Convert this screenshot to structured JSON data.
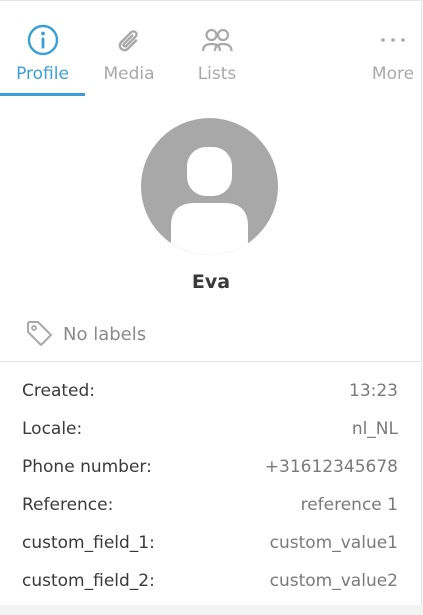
{
  "tabs": [
    {
      "label": "Profile",
      "icon": "info-icon",
      "active": true
    },
    {
      "label": "Media",
      "icon": "paperclip-icon",
      "active": false
    },
    {
      "label": "Lists",
      "icon": "users-icon",
      "active": false
    },
    {
      "label": "More",
      "icon": "more-icon",
      "active": false
    }
  ],
  "contact": {
    "name": "Eva",
    "labels_text": "No labels"
  },
  "details": [
    {
      "key": "Created:",
      "value": "13:23"
    },
    {
      "key": "Locale:",
      "value": "nl_NL"
    },
    {
      "key": "Phone number:",
      "value": "+31612345678"
    },
    {
      "key": "Reference:",
      "value": "reference 1"
    },
    {
      "key": "custom_field_1:",
      "value": "custom_value1"
    },
    {
      "key": "custom_field_2:",
      "value": "custom_value2"
    }
  ],
  "colors": {
    "accent": "#3a9fd9",
    "inactive": "#a9a9a9",
    "avatar": "#a8a8a8"
  }
}
